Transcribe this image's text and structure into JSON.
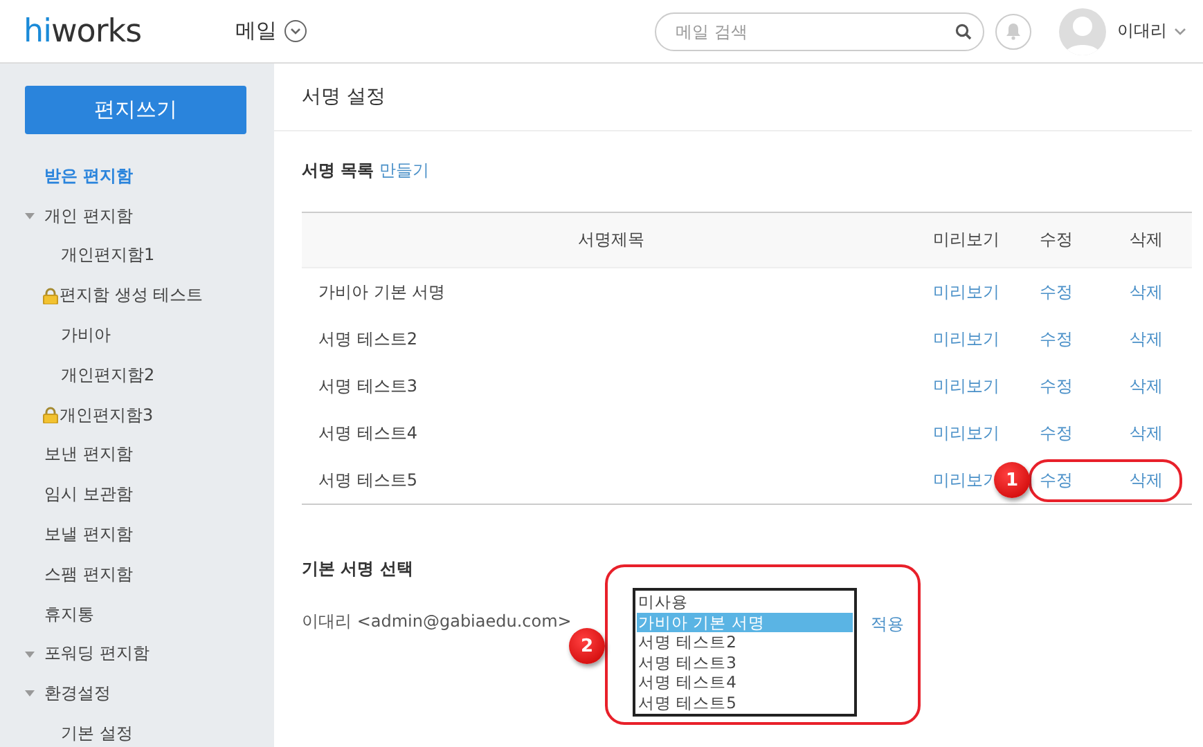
{
  "header": {
    "logo": {
      "accent": "hi",
      "rest": "works"
    },
    "app_menu": "메일",
    "search": {
      "placeholder": "메일 검색"
    },
    "user": "이대리"
  },
  "sidebar": {
    "compose_button": "편지쓰기",
    "items": [
      {
        "label": "받은 편지함",
        "selected": true,
        "locked": false
      },
      {
        "label": "개인 편지함",
        "selected": false,
        "locked": false,
        "expanded": true,
        "children": [
          {
            "label": "개인편지함1",
            "selected": false,
            "locked": false
          },
          {
            "label": "편지함 생성 테스트",
            "selected": false,
            "locked": true
          },
          {
            "label": "가비아",
            "selected": false,
            "locked": false
          },
          {
            "label": "개인편지함2",
            "selected": false,
            "locked": false
          },
          {
            "label": "개인편지함3",
            "selected": false,
            "locked": true
          }
        ]
      },
      {
        "label": "보낸 편지함",
        "selected": false,
        "locked": false
      },
      {
        "label": "임시 보관함",
        "selected": false,
        "locked": false
      },
      {
        "label": "보낼 편지함",
        "selected": false,
        "locked": false
      },
      {
        "label": "스팸 편지함",
        "selected": false,
        "locked": false
      },
      {
        "label": "휴지통",
        "selected": false,
        "locked": false
      },
      {
        "label": "포워딩 편지함",
        "selected": false,
        "locked": false,
        "expanded": true
      },
      {
        "label": "환경설정",
        "selected": false,
        "locked": false,
        "expanded": true,
        "children": [
          {
            "label": "기본 설정",
            "selected": false,
            "locked": false
          }
        ]
      }
    ]
  },
  "page_title": "서명 설정",
  "signature_list": {
    "heading": "서명 목록",
    "create_link": "만들기",
    "columns": [
      "서명제목",
      "미리보기",
      "수정",
      "삭제"
    ],
    "rows": [
      {
        "title": "가비아 기본 서명",
        "preview": "미리보기",
        "edit": "수정",
        "delete": "삭제"
      },
      {
        "title": "서명 테스트2",
        "preview": "미리보기",
        "edit": "수정",
        "delete": "삭제"
      },
      {
        "title": "서명 테스트3",
        "preview": "미리보기",
        "edit": "수정",
        "delete": "삭제"
      },
      {
        "title": "서명 테스트4",
        "preview": "미리보기",
        "edit": "수정",
        "delete": "삭제"
      },
      {
        "title": "서명 테스트5",
        "preview": "미리보기",
        "edit": "수정",
        "delete": "삭제"
      }
    ]
  },
  "default_signature": {
    "heading": "기본 서명 선택",
    "account": "이대리 <admin@gabiaedu.com>",
    "options": [
      {
        "label": "미사용",
        "selected": false
      },
      {
        "label": "가비아 기본 서명",
        "selected": true
      },
      {
        "label": "서명 테스트2",
        "selected": false
      },
      {
        "label": "서명 테스트3",
        "selected": false
      },
      {
        "label": "서명 테스트4",
        "selected": false
      },
      {
        "label": "서명 테스트5",
        "selected": false
      }
    ],
    "apply_link": "적용"
  },
  "annotations": [
    {
      "label": "1"
    },
    {
      "label": "2"
    }
  ]
}
